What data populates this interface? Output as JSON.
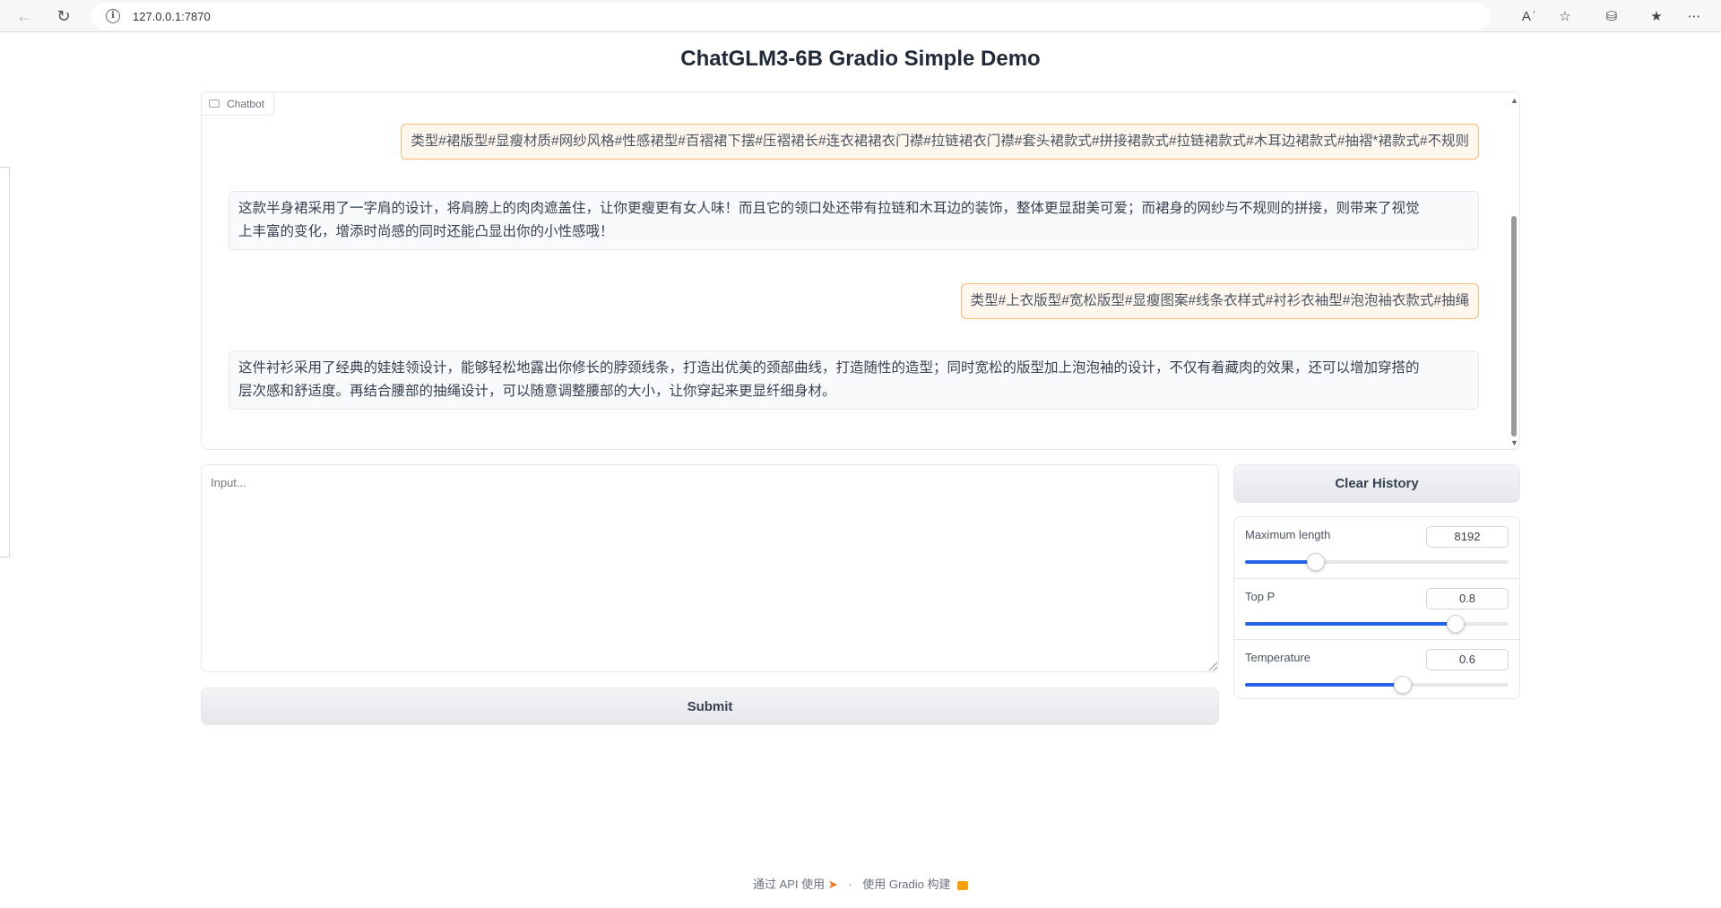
{
  "browser": {
    "url": "127.0.0.1:7870",
    "icons": [
      "back-arrow-icon",
      "reload-icon",
      "info-icon",
      "read-aloud-icon",
      "favorite-star-icon",
      "extensions-icon",
      "favorites-icon",
      "more-icon"
    ]
  },
  "page": {
    "title": "ChatGLM3-6B Gradio Simple Demo"
  },
  "chatbot": {
    "label": "Chatbot",
    "messages": [
      {
        "role": "user",
        "text": "类型#裙版型#显瘦材质#网纱风格#性感裙型#百褶裙下摆#压褶裙长#连衣裙裙衣门襟#拉链裙衣门襟#套头裙款式#拼接裙款式#拉链裙款式#木耳边裙款式#抽褶*裙款式#不规则"
      },
      {
        "role": "bot",
        "line1": "这款半身裙采用了一字肩的设计，将肩膀上的肉肉遮盖住，让你更瘦更有女人味！而且它的领口处还带有拉链和木耳边的装饰，整体更显甜美可爱；而裙身的网纱与不规则的拼接，则带来了视觉",
        "line2": "上丰富的变化，增添时尚感的同时还能凸显出你的小性感哦！"
      },
      {
        "role": "user",
        "text": "类型#上衣版型#宽松版型#显瘦图案#线条衣样式#衬衫衣袖型#泡泡袖衣款式#抽绳"
      },
      {
        "role": "bot",
        "line1": "这件衬衫采用了经典的娃娃领设计，能够轻松地露出你修长的脖颈线条，打造出优美的颈部曲线，打造随性的造型；同时宽松的版型加上泡泡袖的设计，不仅有着藏肉的效果，还可以增加穿搭的",
        "line2": "层次感和舒适度。再结合腰部的抽绳设计，可以随意调整腰部的大小，让你穿起来更显纤细身材。"
      }
    ]
  },
  "input": {
    "placeholder": "Input..."
  },
  "buttons": {
    "submit": "Submit",
    "clear_history": "Clear History"
  },
  "settings": {
    "max_length": {
      "label": "Maximum length",
      "value": "8192",
      "fraction": 0.27
    },
    "top_p": {
      "label": "Top P",
      "value": "0.8",
      "fraction": 0.8
    },
    "temperature": {
      "label": "Temperature",
      "value": "0.6",
      "fraction": 0.6
    }
  },
  "footer": {
    "api_text": "通过 API 使用",
    "separator": "·",
    "built_with": "使用 Gradio 构建"
  },
  "colors": {
    "user_bubble_bg": "#fff7ed",
    "user_bubble_border": "#fdba74",
    "slider_fill": "#2563eb"
  }
}
